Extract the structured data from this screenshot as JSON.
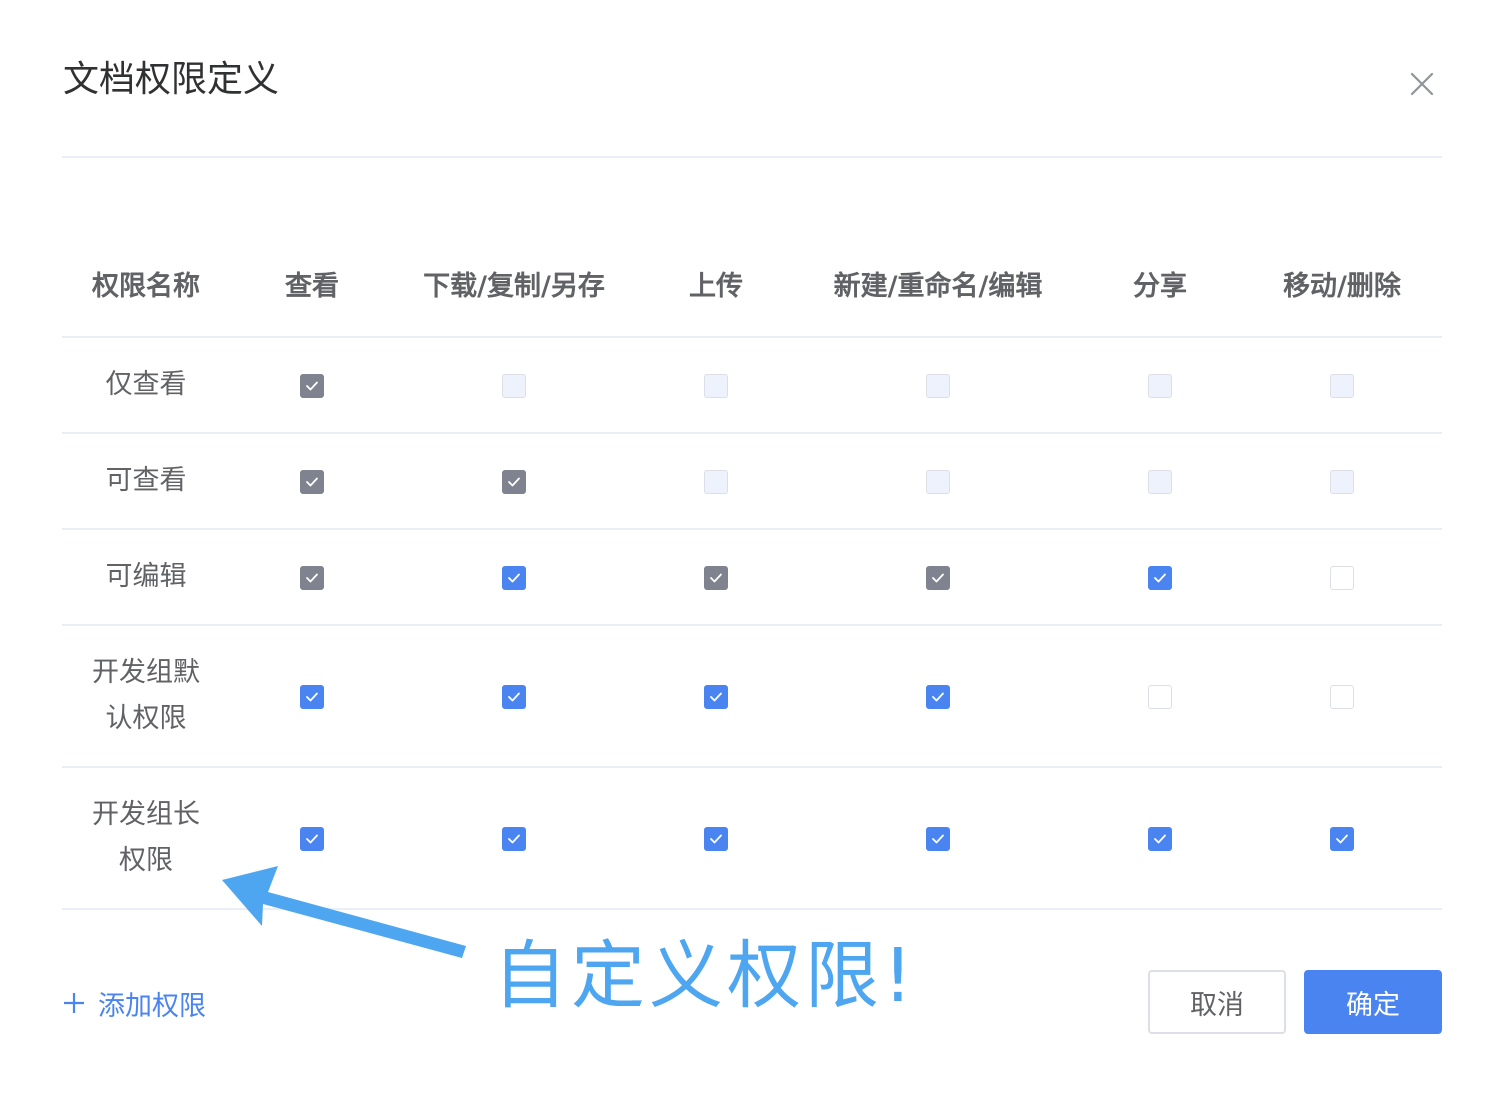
{
  "dialog": {
    "title": "文档权限定义",
    "close_icon": "close-icon"
  },
  "table": {
    "columns": [
      "权限名称",
      "查看",
      "下载/复制/另存",
      "上传",
      "新建/重命名/编辑",
      "分享",
      "移动/删除"
    ],
    "rows": [
      {
        "name": "仅查看",
        "cells": [
          "checked-gray",
          "disabled",
          "disabled",
          "disabled",
          "disabled",
          "disabled"
        ]
      },
      {
        "name": "可查看",
        "cells": [
          "checked-gray",
          "checked-gray",
          "disabled",
          "disabled",
          "disabled",
          "disabled"
        ]
      },
      {
        "name": "可编辑",
        "cells": [
          "checked-gray",
          "checked-blue",
          "checked-gray",
          "checked-gray",
          "checked-blue",
          "empty"
        ]
      },
      {
        "name": "开发组默认权限",
        "cells": [
          "checked-blue",
          "checked-blue",
          "checked-blue",
          "checked-blue",
          "empty",
          "empty"
        ]
      },
      {
        "name": "开发组长权限",
        "cells": [
          "checked-blue",
          "checked-blue",
          "checked-blue",
          "checked-blue",
          "checked-blue",
          "checked-blue"
        ]
      }
    ]
  },
  "footer": {
    "add_label": "添加权限",
    "add_icon": "plus-icon",
    "cancel_label": "取消",
    "confirm_label": "确定"
  },
  "annotation": {
    "text": "自定义权限!"
  },
  "colors": {
    "primary": "#4a84f0",
    "checked_disabled": "#7f8390",
    "annotation": "#4fa6f0"
  }
}
